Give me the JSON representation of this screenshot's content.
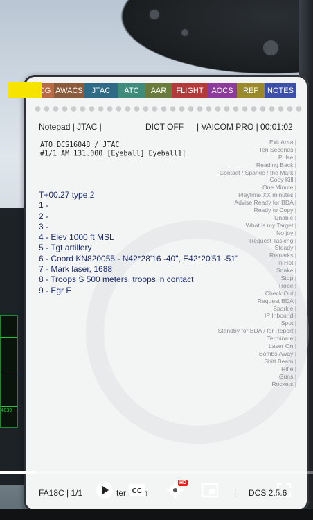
{
  "tabs": [
    {
      "label": "DG",
      "color": "#b86a45",
      "width": 26
    },
    {
      "label": "AWACS",
      "color": "#8b5a3a",
      "width": 44
    },
    {
      "label": "JTAC",
      "color": "#2e6a86",
      "width": 48
    },
    {
      "label": "ATC",
      "color": "#3f8c7a",
      "width": 40
    },
    {
      "label": "AAR",
      "color": "#6a7c3c",
      "width": 38
    },
    {
      "label": "FLIGHT",
      "color": "#b23a3a",
      "width": 52
    },
    {
      "label": "AOCS",
      "color": "#8c3a9c",
      "width": 42
    },
    {
      "label": "REF",
      "color": "#9a8a2c",
      "width": 40
    },
    {
      "label": "NOTES",
      "color": "#3b4fa8",
      "width": 46
    }
  ],
  "header": {
    "left": "Notepad | JTAC |",
    "middle": "DICT OFF",
    "right": "| VAICOM PRO | 00:01:02"
  },
  "ato": {
    "line1": "ATO DCS16048 / JTAC",
    "line2": "#1/1 AM 131.000 [Eyeball] Eyeball1|"
  },
  "brevity": [
    "Exit Area",
    "Ten Seconds",
    "Pulse",
    "Reading Back",
    "Contact / Sparkle / the Mark",
    "Copy Kill",
    "One Minute",
    "Playtime XX minutes",
    "Advise Ready for BDA",
    "Ready to Copy",
    "Unable",
    "What is my Target",
    "No joy",
    "Request Tasking",
    "Steady",
    "Remarks",
    "In Hot",
    "Snake",
    "Stop",
    "Rope",
    "Check Out",
    "Request BDA",
    "Sparkle",
    "IP Inbound",
    "Spot",
    "Standby for BDA / for Report",
    "Terminate",
    "Laser On",
    "Bombs Away",
    "Shift Beam",
    "Rifle",
    "Guns",
    "Rockets"
  ],
  "nine_line": [
    "T+00.27 type 2",
    "1 -",
    "2 -",
    "3 -",
    "4 - Elev 1000 ft MSL",
    "5 - Tgt artillery",
    "6 - Coord KN820055 - N42°28'16 -40\", E42°20'51 -51\"",
    "7 - Mark laser, 1688",
    "8 - Troops S 500 meters, troops in contact",
    "9 - Egr E"
  ],
  "footer": {
    "left": "FA18C | 1/1",
    "middle": "ter    ssion",
    "right_prefix": "|",
    "right": "DCS 2.5.6"
  },
  "mfd": {
    "label": "4030"
  },
  "video": {
    "hd_badge": "HD",
    "progress_fraction": 0.11
  },
  "colors": {
    "yellow_marker": "#f6e300",
    "ink_blue": "#1c2b6b"
  }
}
